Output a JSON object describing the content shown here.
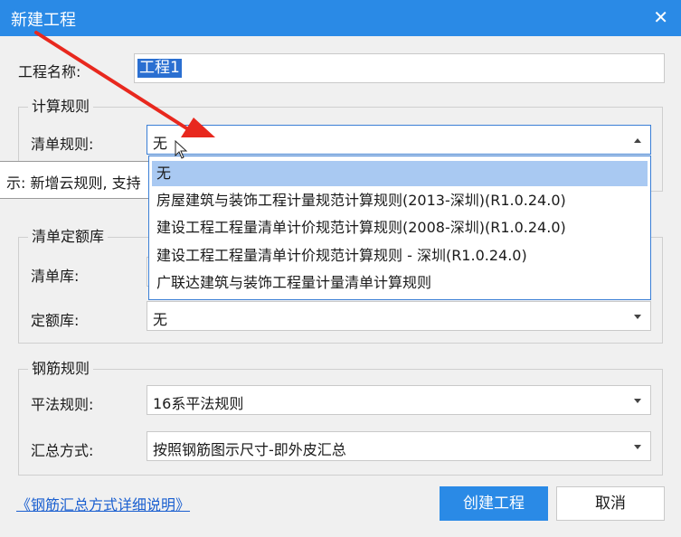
{
  "window": {
    "title": "新建工程",
    "close_glyph": "✕"
  },
  "project_name": {
    "label": "工程名称:",
    "value": "工程1"
  },
  "calc_rules": {
    "legend": "计算规则",
    "bill_rule": {
      "label": "清单规则:",
      "value": "无",
      "options": [
        "无",
        "房屋建筑与装饰工程计量规范计算规则(2013-深圳)(R1.0.24.0)",
        "建设工程工程量清单计价规范计算规则(2008-深圳)(R1.0.24.0)",
        "建设工程工程量清单计价规范计算规则 - 深圳(R1.0.24.0)",
        "广联达建筑与装饰工程量计量清单计算规则"
      ]
    }
  },
  "tooltip": {
    "text": "示: 新增云规则, 支持"
  },
  "quota_lib": {
    "legend": "清单定额库",
    "bill_lib": {
      "label": "清单库:"
    },
    "quota": {
      "label": "定额库:",
      "value": "无"
    }
  },
  "rebar_rules": {
    "legend": "钢筋规则",
    "flat_rule": {
      "label": "平法规则:",
      "value": "16系平法规则"
    },
    "summary_mode": {
      "label": "汇总方式:",
      "value": "按照钢筋图示尺寸-即外皮汇总"
    }
  },
  "footer": {
    "link_text": "《钢筋汇总方式详细说明》",
    "create_label": "创建工程",
    "cancel_label": "取消"
  },
  "colors": {
    "accent": "#2a8ae6",
    "annotation_arrow": "#e8281e",
    "selection": "#a9c9f2"
  }
}
